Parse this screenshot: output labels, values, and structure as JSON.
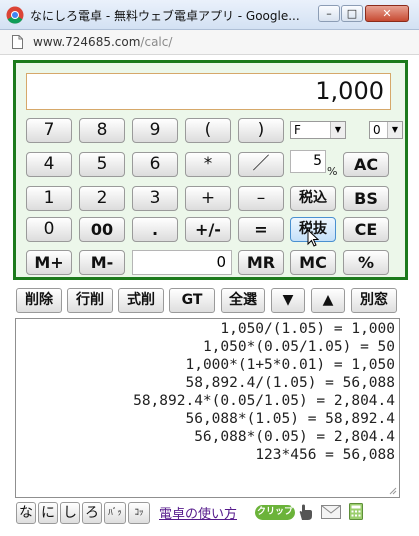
{
  "window": {
    "title": "なにしろ電卓 - 無料ウェブ電卓アプリ - Google...",
    "controls": {
      "minimize": "–",
      "maximize": "□",
      "close": "✕"
    }
  },
  "address": {
    "host": "www.724685.com",
    "path": "/calc/"
  },
  "calculator": {
    "display": "1,000",
    "rows": [
      [
        "7",
        "8",
        "9",
        "(",
        ")"
      ],
      [
        "4",
        "5",
        "6",
        "*",
        "／",
        "AC"
      ],
      [
        "1",
        "2",
        "3",
        "+",
        "–",
        "税込",
        "BS"
      ],
      [
        "0",
        "00",
        ".",
        "+/-",
        "=",
        "税抜",
        "CE"
      ],
      [
        "M+",
        "M-",
        "MR",
        "MC",
        "%"
      ]
    ],
    "rounding_select": "F",
    "digits_select": "0",
    "tax_rate": "5",
    "tax_unit": "%",
    "memory_value": "0"
  },
  "toolbar": [
    "削除",
    "行削",
    "式削",
    "GT",
    "全選",
    "▼",
    "▲",
    "別窓"
  ],
  "history": [
    "1,050/(1.05) = 1,000",
    "1,050*(0.05/1.05) = 50",
    "1,000*(1+5*0.01) = 1,050",
    "58,892.4/(1.05) = 56,088",
    "58,892.4*(0.05/1.05) = 2,804.4",
    "56,088*(1.05) = 58,892.4",
    "56,088*(0.05) = 2,804.4",
    "123*456 = 56,088"
  ],
  "footer": {
    "brand_keys": [
      "な",
      "に",
      "し",
      "ろ",
      "ﾊﾞｯ",
      "ｺｯ"
    ],
    "help_link": "電卓の使い方",
    "clip_label": "クリップ"
  }
}
